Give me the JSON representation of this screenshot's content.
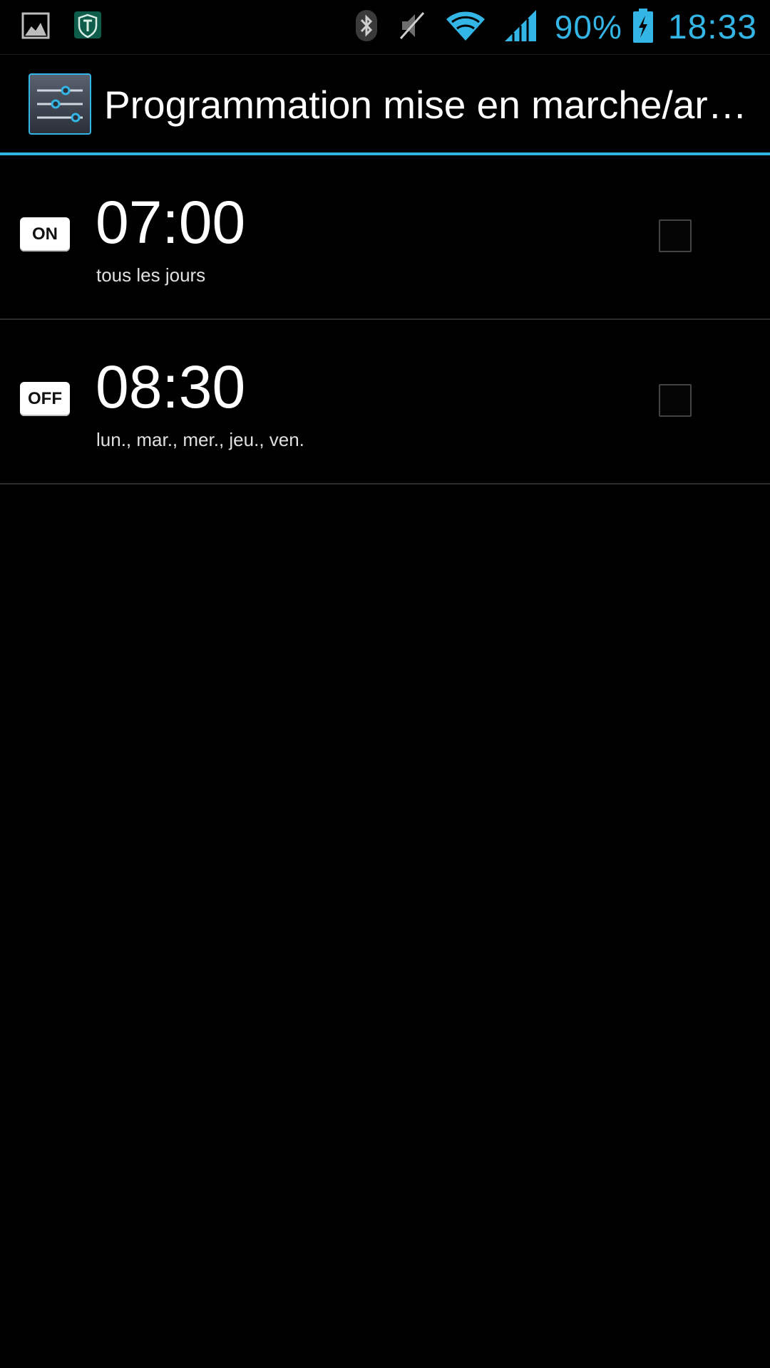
{
  "status_bar": {
    "notification_icons": [
      "image-icon",
      "shield-icon"
    ],
    "system_icons": [
      "bluetooth-icon",
      "vibrate-mute-icon",
      "wifi-icon",
      "signal-icon",
      "battery-charging-icon"
    ],
    "battery_percent": "90%",
    "time": "18:33",
    "accent_color": "#33b5e5"
  },
  "action_bar": {
    "icon": "settings-sliders-icon",
    "title": "Programmation mise en marche/arrêt"
  },
  "schedules": [
    {
      "mode": "ON",
      "time": "07:00",
      "days": "tous les jours",
      "checked": false
    },
    {
      "mode": "OFF",
      "time": "08:30",
      "days": "lun., mar., mer., jeu., ven.",
      "checked": false
    }
  ]
}
